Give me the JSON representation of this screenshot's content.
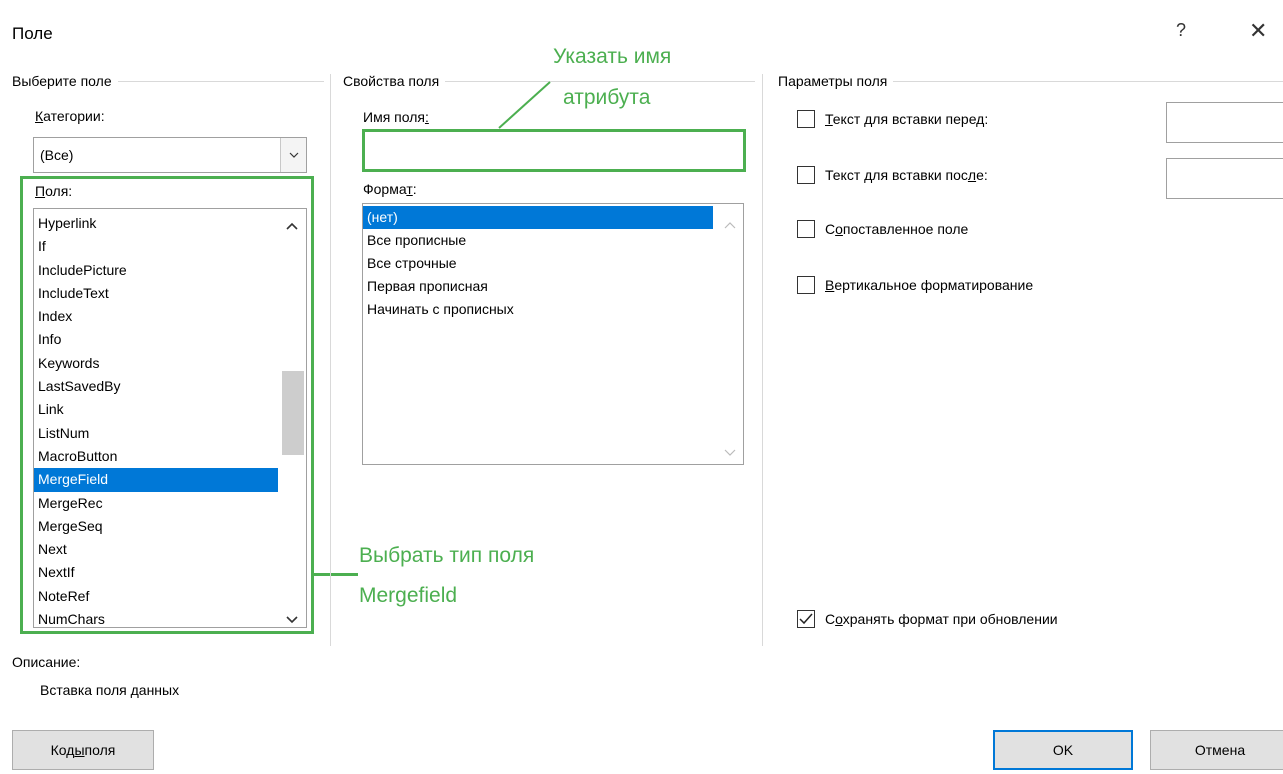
{
  "dialog": {
    "title": "Поле",
    "help_glyph": "?",
    "close_glyph": "✕"
  },
  "select_field": {
    "group_title": "Выберите поле",
    "categories_label_u": "К",
    "categories_label_rest": "атегории:",
    "categories_value": "(Все)",
    "fields_label_u": "П",
    "fields_label_rest": "оля:",
    "fields": [
      "Hyperlink",
      "If",
      "IncludePicture",
      "IncludeText",
      "Index",
      "Info",
      "Keywords",
      "LastSavedBy",
      "Link",
      "ListNum",
      "MacroButton",
      "MergeField",
      "MergeRec",
      "MergeSeq",
      "Next",
      "NextIf",
      "NoteRef",
      "NumChars"
    ],
    "selected_field": "MergeField",
    "scroll_up": "⌃",
    "scroll_down": "⌄"
  },
  "field_properties": {
    "group_title": "Свойства поля",
    "name_label_pre": "Имя поля",
    "name_label_u": ":",
    "name_value": "",
    "format_label_pre": "Форма",
    "format_label_u": "т",
    "format_label_post": ":",
    "formats": [
      "(нет)",
      "Все прописные",
      "Все строчные",
      "Первая прописная",
      "Начинать с прописных"
    ],
    "selected_format": "(нет)"
  },
  "field_options": {
    "group_title": "Параметры поля",
    "text_before_u": "Т",
    "text_before_rest": "екст для вставки перед:",
    "text_after_pre": "Текст для вставки пос",
    "text_after_u": "л",
    "text_after_post": "е:",
    "mapped_pre": "С",
    "mapped_u": "о",
    "mapped_post": "поставленное поле",
    "vertical_u": "В",
    "vertical_rest": "ертикальное форматирование",
    "preserve_pre": "С",
    "preserve_u": "о",
    "preserve_post": "хранять формат при обновлении",
    "checked": {
      "text_before": false,
      "text_after": false,
      "mapped": false,
      "vertical": false,
      "preserve": true
    }
  },
  "description": {
    "label": "Описание:",
    "text": "Вставка поля данных"
  },
  "buttons": {
    "field_codes_pre": "Код",
    "field_codes_u": "ы",
    "field_codes_post": " поля",
    "ok": "OK",
    "cancel": "Отмена"
  },
  "annotations": {
    "name_line1": "Указать имя",
    "name_line2": "атрибута",
    "type_line1": "Выбрать тип поля",
    "type_line2": "Mergefield"
  },
  "colors": {
    "accent": "#0078d7",
    "annotation_green": "#4caf50"
  }
}
